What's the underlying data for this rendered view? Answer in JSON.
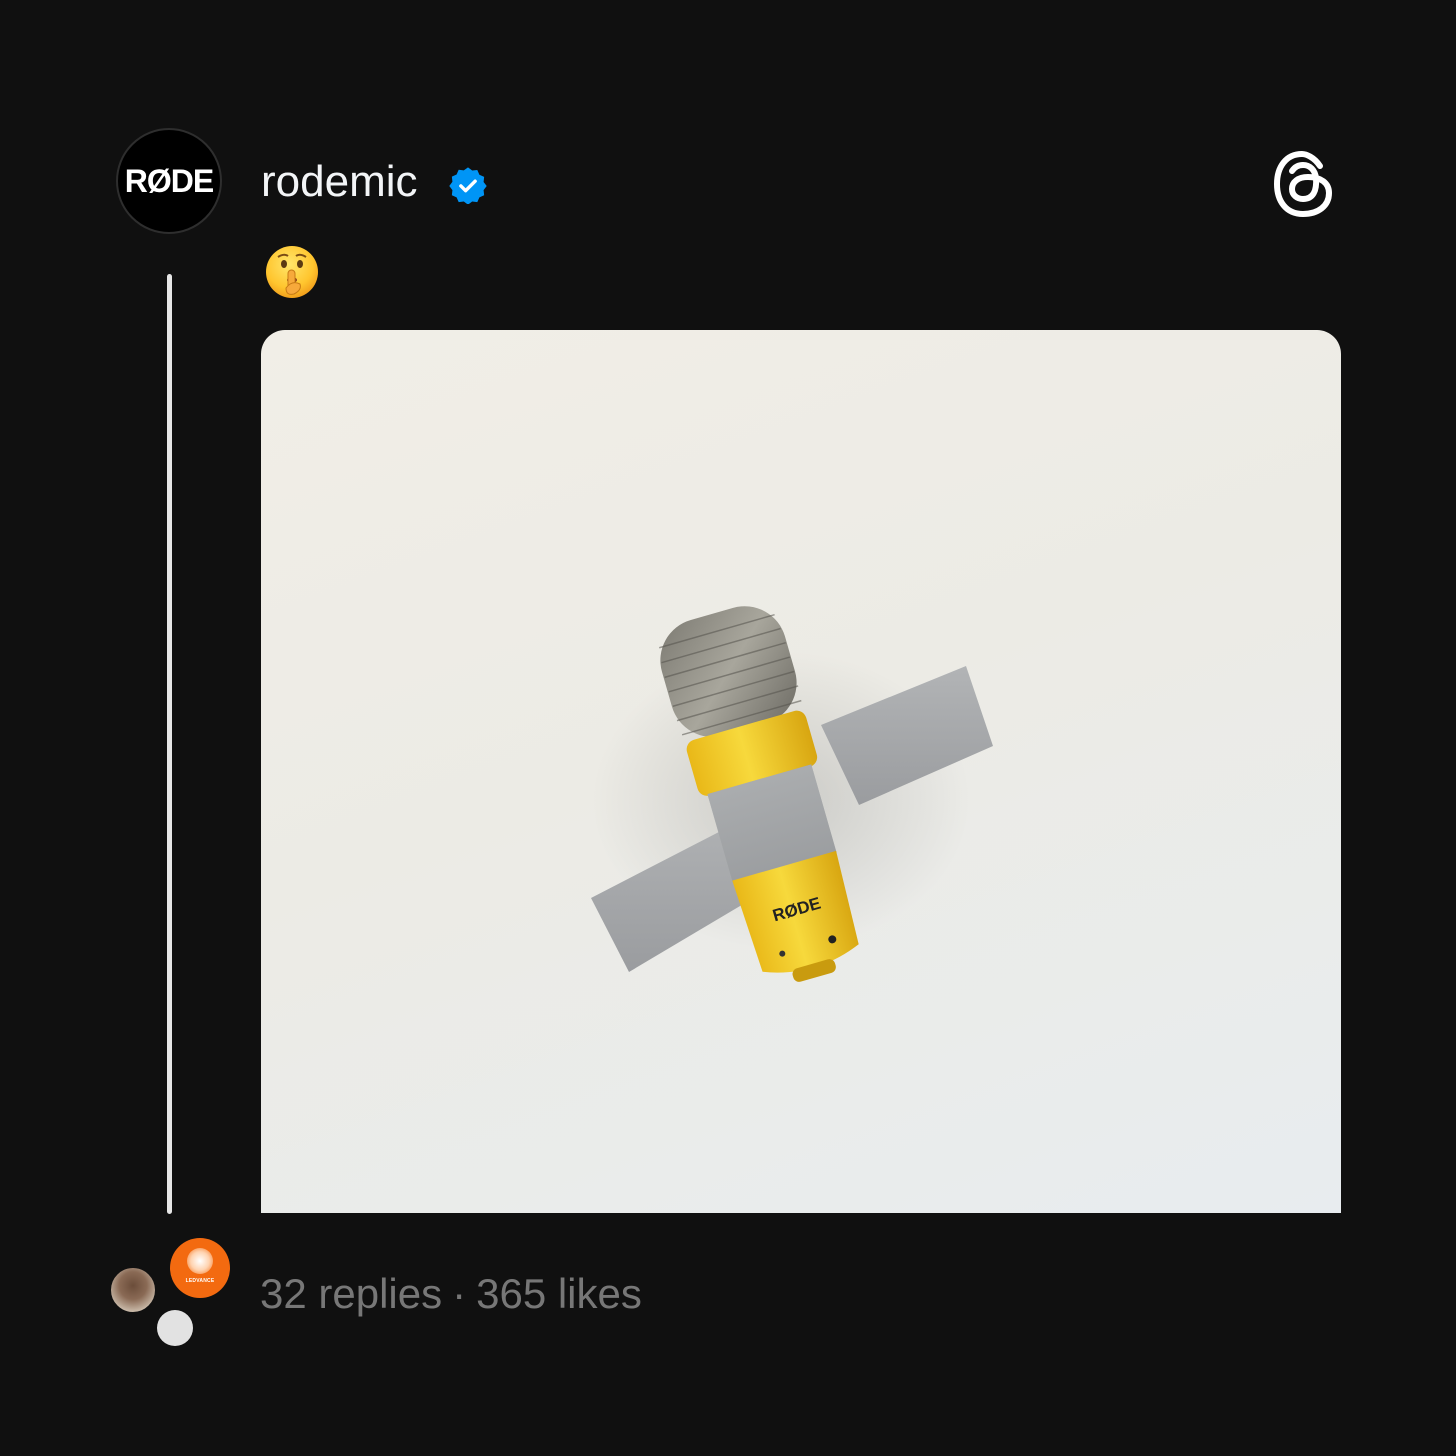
{
  "post": {
    "author": {
      "username": "rodemic",
      "avatar_logo_text": "RØDE",
      "verified": true,
      "verified_icon": "verified-badge-icon",
      "verified_color": "#0095f6"
    },
    "app_icon": "threads-logo-icon",
    "text": "🤫",
    "media": {
      "image_icon": "photo-microphone-taped-to-wall",
      "brand_text_on_mic": "RØDE",
      "colors": {
        "mic_body": "#f2cc2c",
        "tape": "#a9abad",
        "wall": "#eeede7"
      }
    },
    "stats": {
      "replies": "32 replies",
      "separator": "·",
      "likes": "365 likes"
    },
    "reply_avatars": [
      {
        "icon": "user-avatar-photo"
      },
      {
        "icon": "ledvance-avatar",
        "text": "LEDVANCE"
      },
      {
        "icon": "gray-avatar"
      }
    ]
  }
}
